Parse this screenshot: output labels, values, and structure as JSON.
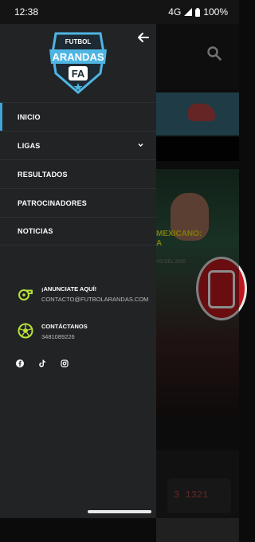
{
  "status_bar": {
    "time": "12:38",
    "network": "4G",
    "battery": "100%"
  },
  "drawer": {
    "logo": {
      "top_text": "FUTBOL",
      "main_text": "ARANDAS",
      "monogram": "FA"
    },
    "menu": [
      {
        "label": "INICIO",
        "active": true
      },
      {
        "label": "LIGAS",
        "has_submenu": true
      },
      {
        "label": "RESULTADOS"
      },
      {
        "label": "PATROCINADORES"
      },
      {
        "label": "NOTICIAS"
      }
    ],
    "advertise": {
      "title": "¡ANUNCIATE AQUÍ!",
      "email": "CONTACTO@FUTBOLARANDAS.COM"
    },
    "contact": {
      "title": "CONTÁCTANOS",
      "phone": "3481089226"
    },
    "social_icons": [
      "facebook-icon",
      "tiktok-icon",
      "instagram-icon"
    ],
    "accent_color": "#3fa3d8",
    "icon_color": "#b6e23a"
  },
  "background_page": {
    "headline_lines": [
      "MEXICANO:",
      "A"
    ],
    "date": "YO DEL 2025",
    "ticket_text": "3 1321"
  }
}
